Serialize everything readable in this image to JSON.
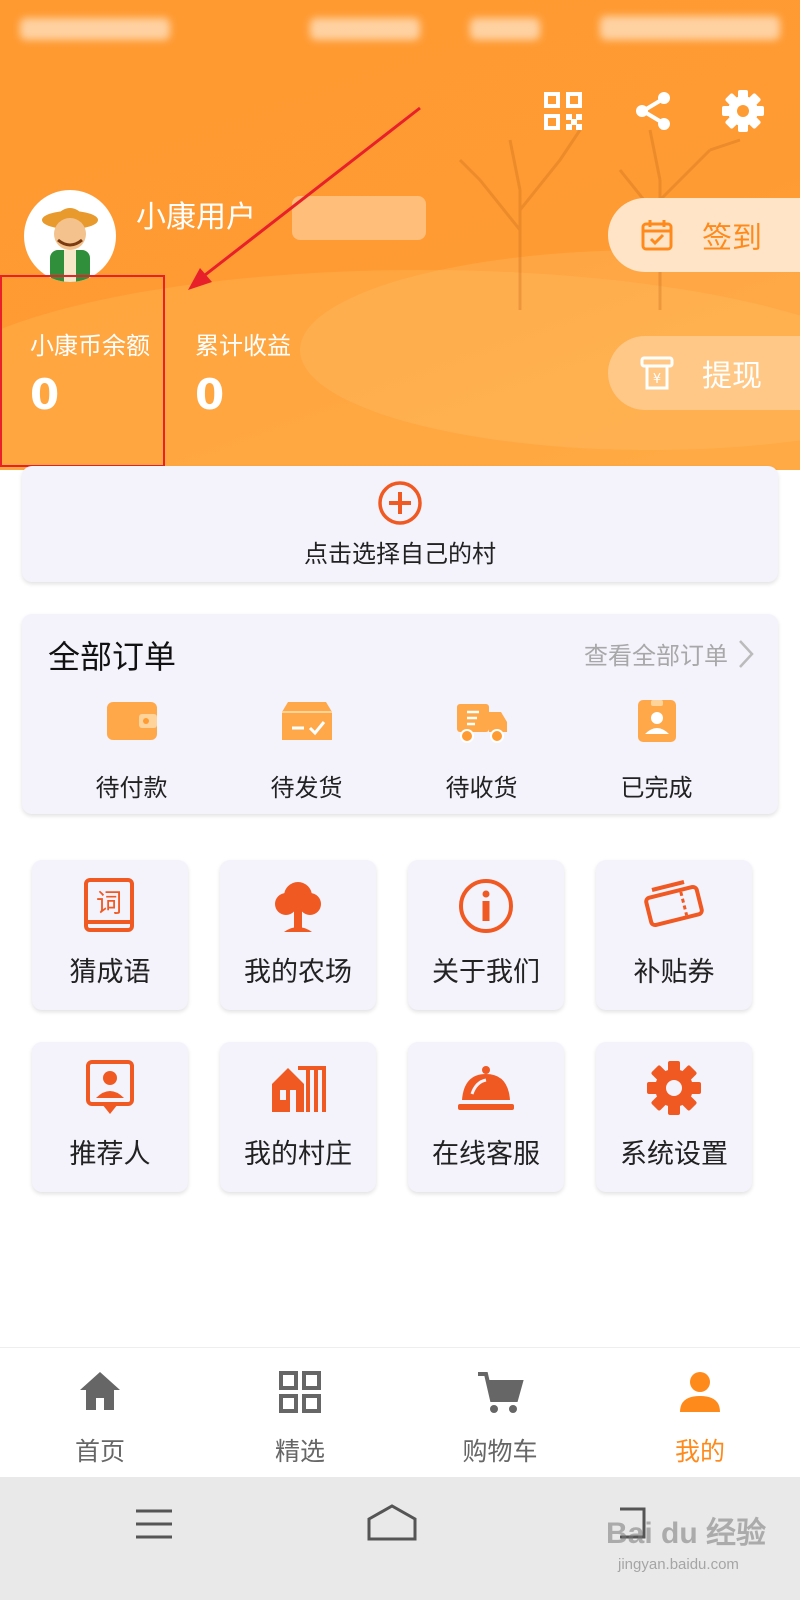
{
  "header": {
    "username": "小康用户",
    "stats": [
      {
        "label": "小康币余额",
        "value": "0"
      },
      {
        "label": "累计收益",
        "value": "0"
      }
    ],
    "sign_in": "签到",
    "withdraw": "提现"
  },
  "village": {
    "label": "点击选择自己的村"
  },
  "orders": {
    "title": "全部订单",
    "view_all": "查看全部订单",
    "items": [
      {
        "label": "待付款",
        "icon": "wallet-icon"
      },
      {
        "label": "待发货",
        "icon": "package-icon"
      },
      {
        "label": "待收货",
        "icon": "delivery-truck-icon"
      },
      {
        "label": "已完成",
        "icon": "badge-icon"
      }
    ]
  },
  "tools": [
    {
      "label": "猜成语",
      "icon": "dictionary-icon"
    },
    {
      "label": "我的农场",
      "icon": "tree-icon"
    },
    {
      "label": "关于我们",
      "icon": "info-icon"
    },
    {
      "label": "补贴券",
      "icon": "ticket-icon"
    },
    {
      "label": "推荐人",
      "icon": "referrer-icon"
    },
    {
      "label": "我的村庄",
      "icon": "village-icon"
    },
    {
      "label": "在线客服",
      "icon": "service-bell-icon"
    },
    {
      "label": "系统设置",
      "icon": "gear-icon"
    }
  ],
  "tabbar": [
    {
      "label": "首页",
      "icon": "home-icon",
      "active": false
    },
    {
      "label": "精选",
      "icon": "grid-icon",
      "active": false
    },
    {
      "label": "购物车",
      "icon": "cart-icon",
      "active": false
    },
    {
      "label": "我的",
      "icon": "person-icon",
      "active": true
    }
  ],
  "watermark": {
    "text": "Bai du 经验",
    "sub": "jingyan.baidu.com"
  },
  "colors": {
    "brand": "#ff9b33",
    "accent": "#f05a22",
    "highlight": "#e8202a",
    "card_bg": "#f4f2fb"
  }
}
